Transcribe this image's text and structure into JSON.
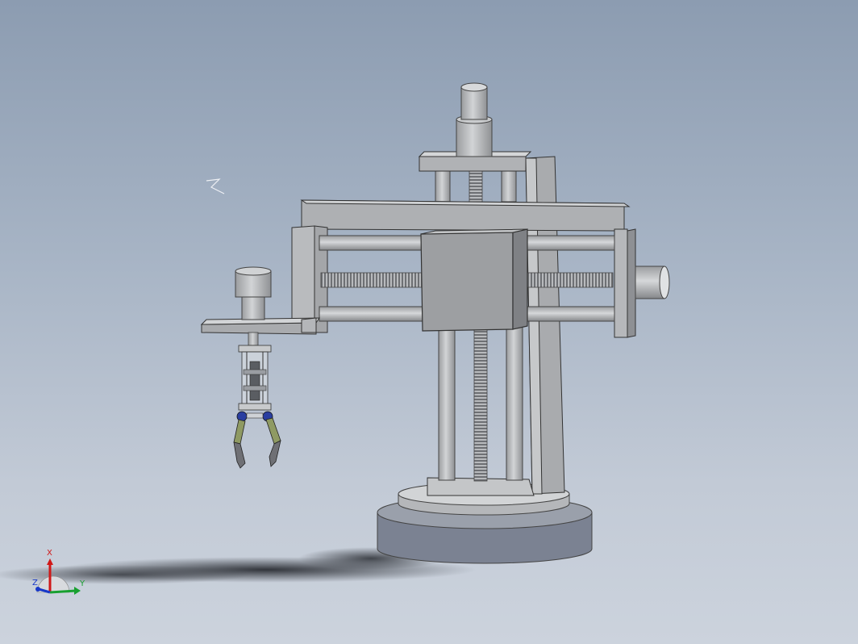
{
  "viewport": {
    "background_top": "#8c9cb1",
    "background_bottom": "#ccd3dd"
  },
  "model": {
    "part_color": "#b9bbbd",
    "base_color": "#7b8292",
    "gripper_joint_color": "#2a3ea0",
    "gripper_finger_color": "#8f9a63"
  },
  "triad": {
    "x_label": "X",
    "y_label": "Y",
    "z_label": "Z",
    "x_color": "#d01818",
    "y_color": "#18a030",
    "z_color": "#1838c8"
  }
}
